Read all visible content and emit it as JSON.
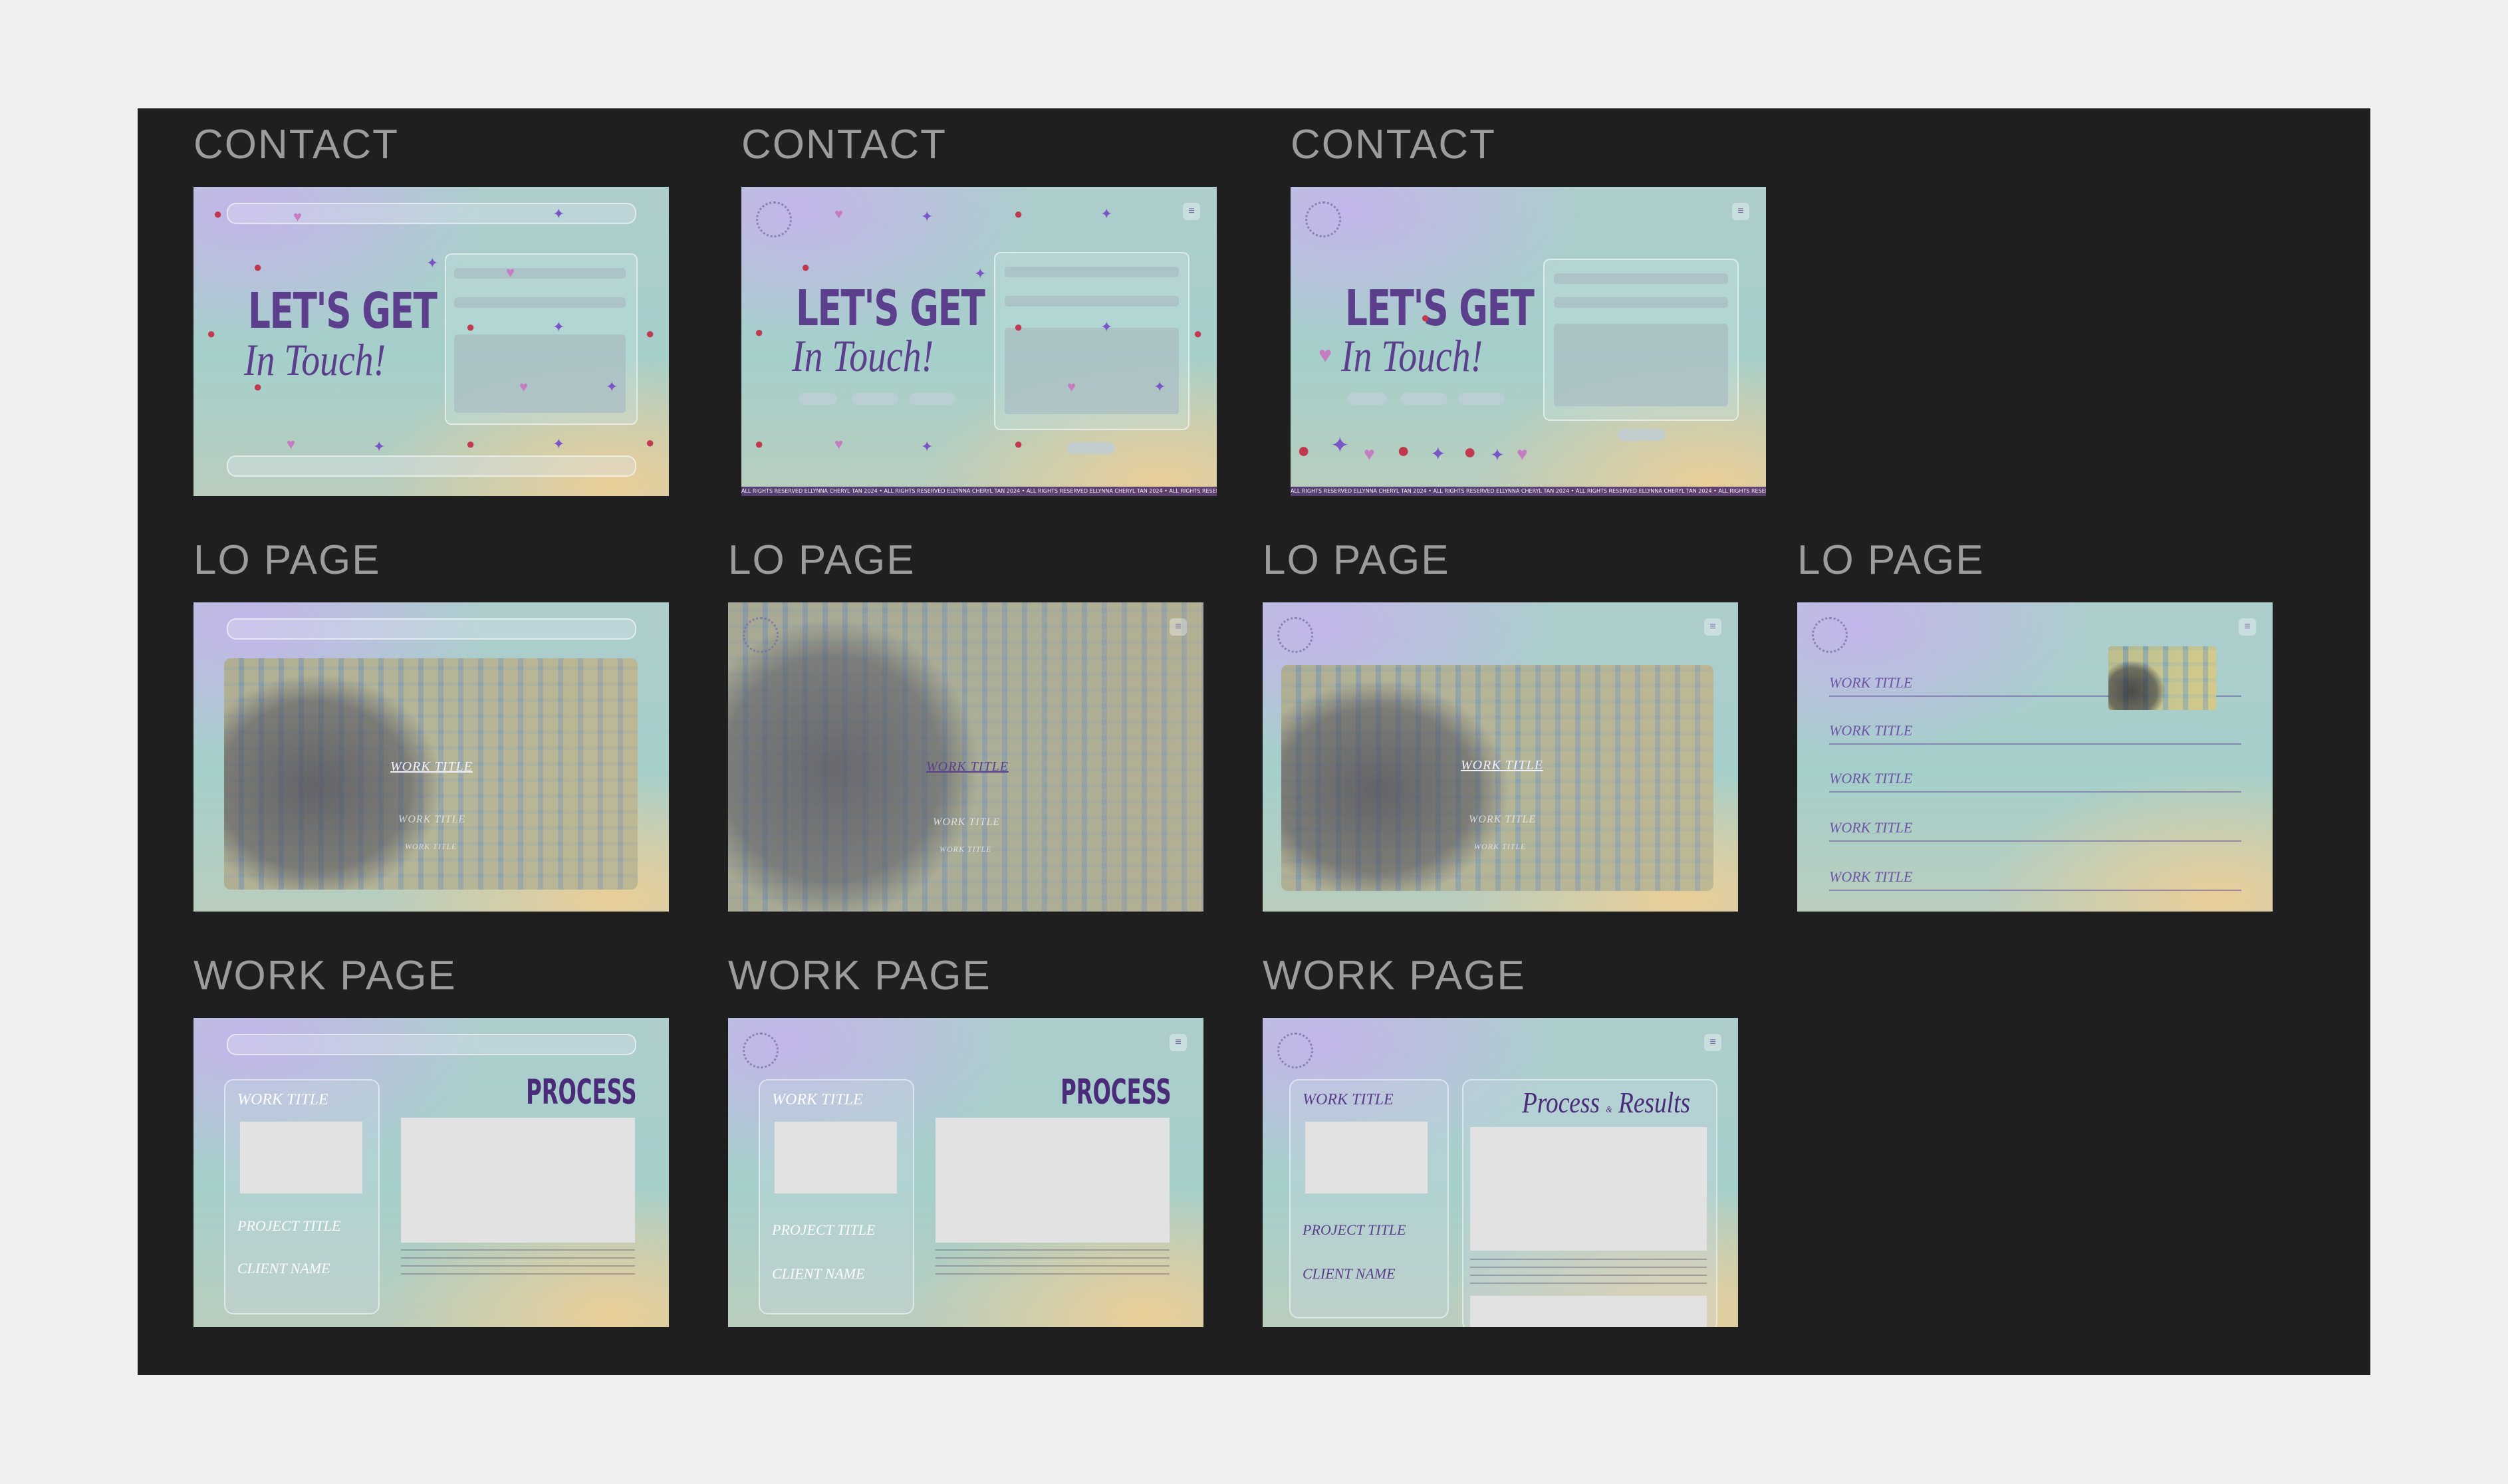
{
  "rows": [
    {
      "label": "CONTACT"
    },
    {
      "label": "LO PAGE"
    },
    {
      "label": "WORK PAGE"
    }
  ],
  "contact": {
    "heading_line1": "LET'S GET",
    "heading_line2": "In Touch!",
    "footer_text": "ALL RIGHTS RESERVED ELLYNNA CHERYL TAN 2024 • ALL RIGHTS RESERVED ELLYNNA CHERYL TAN 2024 • ALL RIGHTS RESERVED ELLYNNA CHERYL TAN 2024 • ALL RIGHTS RESERVED ELLYNNA"
  },
  "lo_page": {
    "work_title": "WORK TITLE"
  },
  "work_page": {
    "work_title": "WORK TITLE",
    "project_title": "PROJECT TITLE",
    "client_name": "CLIENT NAME",
    "process_heading": "PROCESS",
    "process_results_left": "Process",
    "process_results_right": "Results"
  },
  "colors": {
    "canvas_bg": "#1f1f1f",
    "outer_bg": "#efefef",
    "label_gray": "#9c9c9c",
    "heading_purple": "#5b3f8c"
  },
  "icons": {
    "deco_strawberry": "strawberry-icon",
    "deco_heart": "heart-icon",
    "deco_sparkle": "sparkle-icon"
  }
}
